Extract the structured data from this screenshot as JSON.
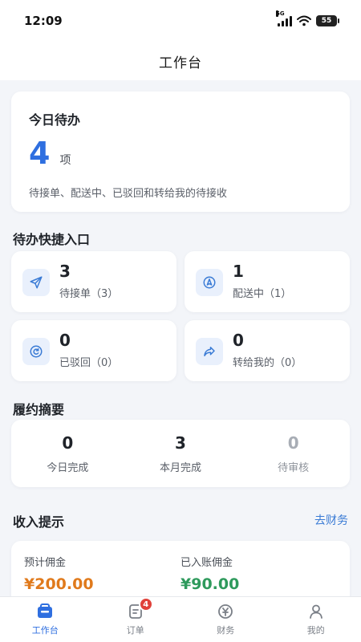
{
  "status_bar": {
    "time": "12:09",
    "network": "5G",
    "battery": "55"
  },
  "header": {
    "title": "工作台"
  },
  "today": {
    "title": "今日待办",
    "count": "4",
    "unit": "项",
    "desc": "待接单、配送中、已驳回和转给我的待接收"
  },
  "quick": {
    "title": "待办快捷入口",
    "items": [
      {
        "num": "3",
        "label": "待接单（3）",
        "icon": "send-icon"
      },
      {
        "num": "1",
        "label": "配送中（1）",
        "icon": "navigation-icon"
      },
      {
        "num": "0",
        "label": "已驳回（0）",
        "icon": "rejected-icon"
      },
      {
        "num": "0",
        "label": "转给我的（0）",
        "icon": "forward-icon"
      }
    ]
  },
  "summary": {
    "title": "履约摘要",
    "items": [
      {
        "value": "0",
        "label": "今日完成"
      },
      {
        "value": "3",
        "label": "本月完成"
      },
      {
        "value": "0",
        "label": "待审核"
      }
    ]
  },
  "income": {
    "title": "收入提示",
    "link": "去财务",
    "items": [
      {
        "label": "预计佣金",
        "value": "¥200.00"
      },
      {
        "label": "已入账佣金",
        "value": "¥90.00"
      }
    ]
  },
  "tabbar": {
    "items": [
      {
        "label": "工作台",
        "icon": "workbench-icon"
      },
      {
        "label": "订单",
        "icon": "order-icon",
        "badge": "4"
      },
      {
        "label": "财务",
        "icon": "finance-icon"
      },
      {
        "label": "我的",
        "icon": "profile-icon"
      }
    ]
  },
  "colors": {
    "accent": "#2f6fe0",
    "orange": "#e07a1c",
    "green": "#2e9a5c",
    "badge": "#e0413a"
  }
}
